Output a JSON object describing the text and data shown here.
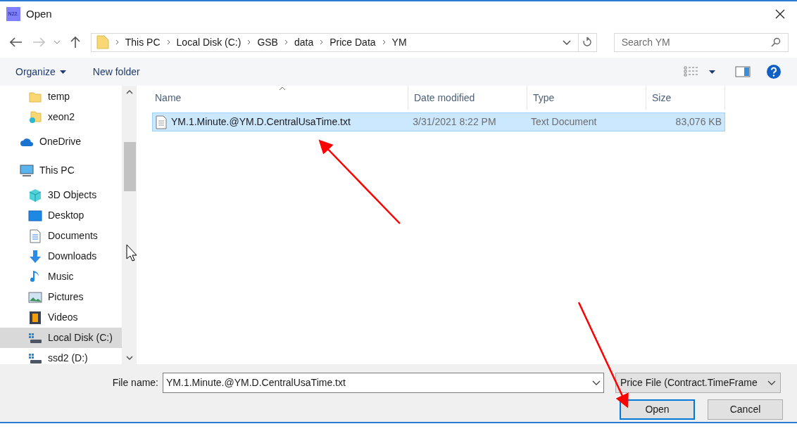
{
  "window": {
    "title": "Open",
    "icon_text": "N22."
  },
  "nav": {
    "path": [
      "This PC",
      "Local Disk (C:)",
      "GSB",
      "data",
      "Price Data",
      "YM"
    ],
    "search": {
      "placeholder": "Search YM"
    }
  },
  "toolbar": {
    "organize": "Organize",
    "new_folder": "New folder"
  },
  "sidebar": {
    "items": [
      {
        "children": [
          {
            "label": "temp",
            "kind": "folder",
            "selected": false
          },
          {
            "label": "xeon2",
            "kind": "shared-folder",
            "selected": false
          }
        ]
      },
      {
        "label": "OneDrive",
        "kind": "cloud",
        "selected": false
      },
      {
        "label": "This PC",
        "kind": "computer",
        "selected": false,
        "children": [
          {
            "label": "3D Objects",
            "kind": "cube",
            "selected": false
          },
          {
            "label": "Desktop",
            "kind": "desktop",
            "selected": false
          },
          {
            "label": "Documents",
            "kind": "documents",
            "selected": false
          },
          {
            "label": "Downloads",
            "kind": "downloads",
            "selected": false
          },
          {
            "label": "Music",
            "kind": "music",
            "selected": false
          },
          {
            "label": "Pictures",
            "kind": "pictures",
            "selected": false
          },
          {
            "label": "Videos",
            "kind": "videos",
            "selected": false
          },
          {
            "label": "Local Disk (C:)",
            "kind": "drive",
            "selected": true
          },
          {
            "label": "ssd2 (D:)",
            "kind": "drive",
            "selected": false
          }
        ]
      }
    ]
  },
  "table": {
    "columns": [
      {
        "label": "Name",
        "sorted": true
      },
      {
        "label": "Date modified",
        "sorted": false
      },
      {
        "label": "Type",
        "sorted": false
      },
      {
        "label": "Size",
        "sorted": false
      }
    ],
    "rows": [
      {
        "cells": [
          "YM.1.Minute.@YM.D.CentralUsaTime.txt",
          "3/31/2021 8:22 PM",
          "Text Document",
          "83,076 KB"
        ],
        "selected": true
      }
    ]
  },
  "footer": {
    "file_name_label": "File name:",
    "file_name": "YM.1.Minute.@YM.D.CentralUsaTime.txt",
    "file_type": "Price File (Contract.TimeFrame",
    "buttons": [
      {
        "label": "Open",
        "default": true
      },
      {
        "label": "Cancel",
        "default": false
      }
    ]
  }
}
